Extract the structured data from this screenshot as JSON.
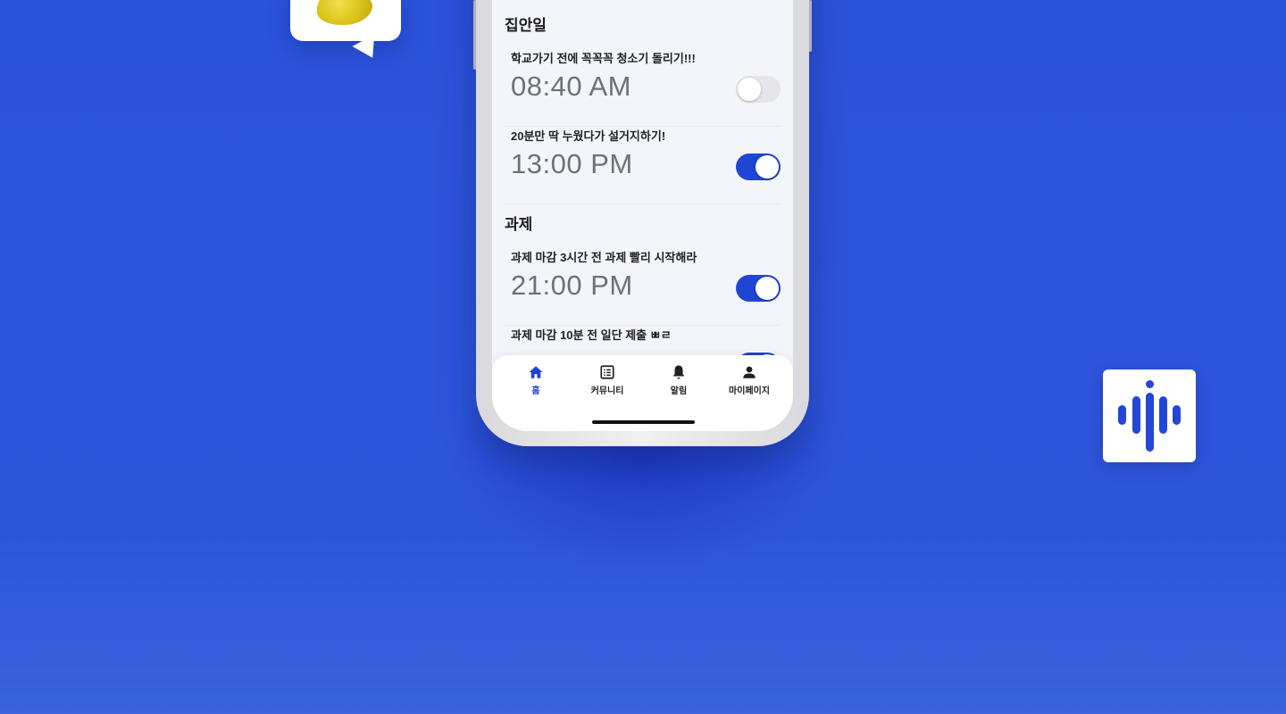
{
  "colors": {
    "accent": "#1f45d3",
    "background": "#2b52db",
    "toggle_off": "#e6e6ea"
  },
  "sections": [
    {
      "title": "집안일",
      "items": [
        {
          "title": "학교가기 전에 꼭꼭꼭 청소기 돌리기!!!",
          "time": "08:40 AM",
          "enabled": false
        },
        {
          "title": "20분만 딱 누웠다가 설거지하기!",
          "time": "13:00 PM",
          "enabled": true
        }
      ]
    },
    {
      "title": "과제",
      "items": [
        {
          "title": "과제 마감 3시간 전 과제 빨리 시작해라",
          "time": "21:00 PM",
          "enabled": true
        },
        {
          "title": "과제 마감 10분 전 일단 제출 ㅃㄹ",
          "time": "",
          "enabled": true
        }
      ]
    }
  ],
  "tabbar": {
    "tabs": [
      {
        "label": "홈",
        "icon": "home-icon",
        "active": true
      },
      {
        "label": "커뮤니티",
        "icon": "list-icon",
        "active": false
      },
      {
        "label": "알림",
        "icon": "bell-icon",
        "active": false
      },
      {
        "label": "마이페이지",
        "icon": "person-icon",
        "active": false
      }
    ]
  }
}
